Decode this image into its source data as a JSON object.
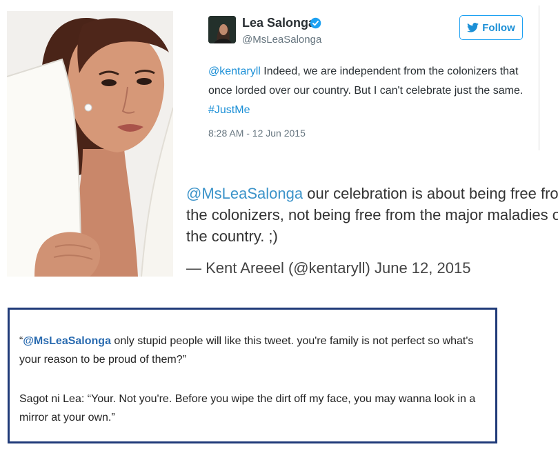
{
  "tweet": {
    "display_name": "Lea Salonga",
    "handle": "@MsLeaSalonga",
    "follow_label": "Follow",
    "text_mention": "@kentaryll",
    "text_line1_rest": " Indeed, we are independent from the colonizers that",
    "text_line2": "once lorded over our country. But I can't celebrate just the same.",
    "hashtag": "#JustMe",
    "timestamp": "8:28 AM - 12 Jun 2015",
    "colors": {
      "link": "#1b8fd6",
      "verified": "#1da1f2"
    }
  },
  "embedded_tweet": {
    "mention": "@MsLeaSalonga",
    "line1_rest": " our celebration is about being free from",
    "line2": "the colonizers, not being free from the major maladies of",
    "line3": "the country. ;)",
    "attribution": "— Kent Areeel (@kentaryll) June 12, 2015"
  },
  "reply_box": {
    "quote_open": "“",
    "mention": "@MsLeaSalonga",
    "quote_line1_rest": " only stupid people will like this tweet. you're family is not perfect so what's",
    "quote_line2": "your reason to be proud of them?”",
    "answer_line1": "Sagot ni Lea: “Your. Not you're. Before you wipe the dirt off my face, you may wanna look in a",
    "answer_line2": "mirror at your own.”",
    "border_color": "#1f3a78"
  },
  "icons": {
    "verified": "verified-badge-icon",
    "follow": "twitter-bird-icon"
  }
}
